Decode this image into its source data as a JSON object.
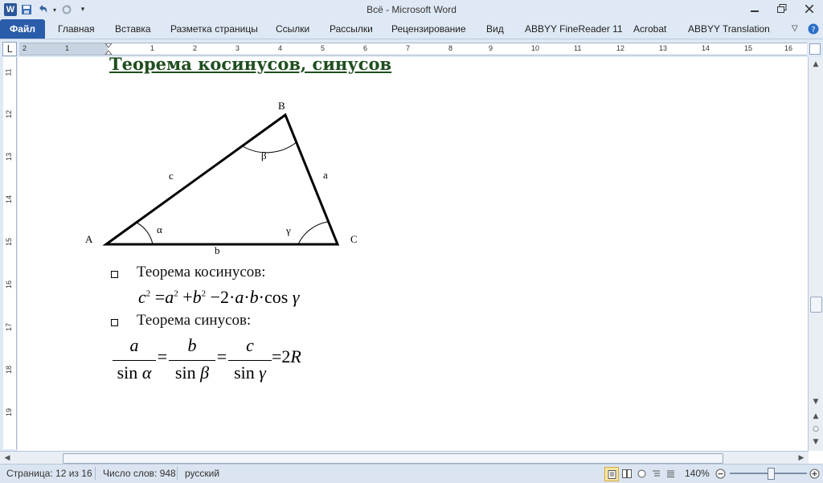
{
  "window": {
    "title": "Всё  -  Microsoft Word"
  },
  "ribbon_tabs": [
    "Файл",
    "Главная",
    "Вставка",
    "Разметка страницы",
    "Ссылки",
    "Рассылки",
    "Рецензирование",
    "Вид",
    "ABBYY FineReader 11",
    "Acrobat",
    "ABBYY Translation"
  ],
  "ruler": {
    "numbers": [
      "2",
      "1",
      "1",
      "2",
      "3",
      "4",
      "5",
      "6",
      "7",
      "8",
      "9",
      "10",
      "11",
      "12",
      "13",
      "14",
      "15",
      "16"
    ],
    "vertical_numbers": [
      "11",
      "12",
      "13",
      "14",
      "15",
      "16",
      "17",
      "18",
      "19"
    ]
  },
  "document": {
    "heading": "Теорема косинусов, синусов",
    "triangle": {
      "A": "A",
      "B": "B",
      "C": "C",
      "a": "a",
      "b": "b",
      "c": "c",
      "alpha": "α",
      "beta": "β",
      "gamma": "γ"
    },
    "bullet1": "Теорема косинусов:",
    "bullet2": "Теорема синусов:",
    "cos_formula": {
      "c": "c",
      "exp": "2",
      "eq": "=",
      "a": "a",
      "plus": "+",
      "b": "b",
      "minus": "−2·",
      "rest_a": "a",
      "dot": "·",
      "rest_b": "b",
      "cos": "·cos ",
      "gamma": "γ"
    },
    "sin_formula": {
      "n1": "a",
      "d1_sin": "sin ",
      "d1": "α",
      "n2": "b",
      "d2_sin": "sin ",
      "d2": "β",
      "n3": "c",
      "d3_sin": "sin ",
      "d3": "γ",
      "eq": "=",
      "result": "=2",
      "R": "R"
    }
  },
  "status": {
    "page": "Страница: 12 из 16",
    "words": "Число слов: 948",
    "lang": "русский",
    "zoom": "140%"
  }
}
